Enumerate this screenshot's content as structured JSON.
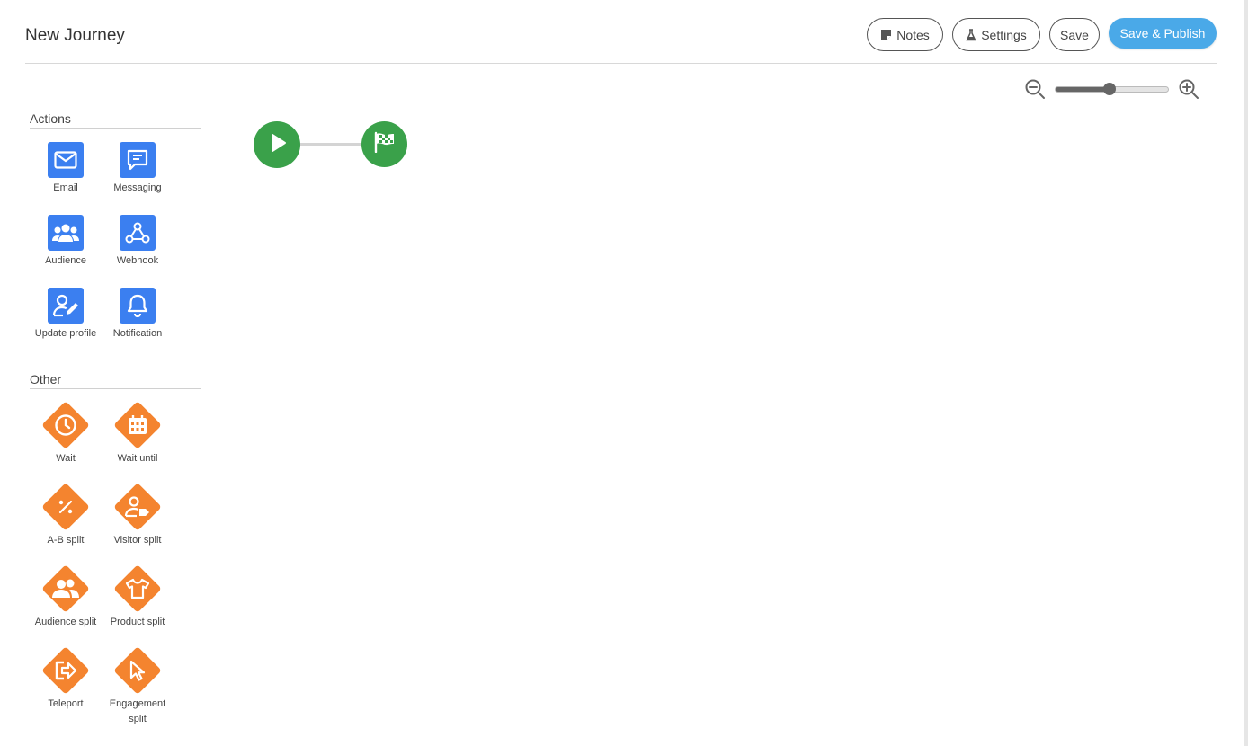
{
  "header": {
    "title": "New Journey",
    "buttons": {
      "notes": "Notes",
      "settings": "Settings",
      "save": "Save",
      "save_publish": "Save & Publish"
    }
  },
  "zoom": {
    "level": 0.48
  },
  "sidebar": {
    "actions": {
      "title": "Actions",
      "items": [
        {
          "label": "Email",
          "icon": "envelope-icon"
        },
        {
          "label": "Messaging",
          "icon": "chat-icon"
        },
        {
          "label": "Audience",
          "icon": "users-icon"
        },
        {
          "label": "Webhook",
          "icon": "webhook-icon"
        },
        {
          "label": "Update profile",
          "icon": "user-edit-icon"
        },
        {
          "label": "Notification",
          "icon": "bell-icon"
        }
      ]
    },
    "other": {
      "title": "Other",
      "items": [
        {
          "label": "Wait",
          "icon": "clock-icon"
        },
        {
          "label": "Wait until",
          "icon": "calendar-icon"
        },
        {
          "label": "A-B split",
          "icon": "percent-icon"
        },
        {
          "label": "Visitor split",
          "icon": "user-tag-icon"
        },
        {
          "label": "Audience split",
          "icon": "users-icon"
        },
        {
          "label": "Product split",
          "icon": "shirt-icon"
        },
        {
          "label": "Teleport",
          "icon": "teleport-icon"
        },
        {
          "label": "Engagement split",
          "icon": "cursor-icon"
        }
      ]
    }
  },
  "canvas": {
    "nodes": [
      {
        "type": "start",
        "icon": "play-icon"
      },
      {
        "type": "end",
        "icon": "finish-flag-icon"
      }
    ]
  },
  "colors": {
    "accent": "#4aa9e8",
    "action_blue": "#3b7ff0",
    "other_orange": "#f4842f",
    "flow_green": "#3aa14a"
  }
}
